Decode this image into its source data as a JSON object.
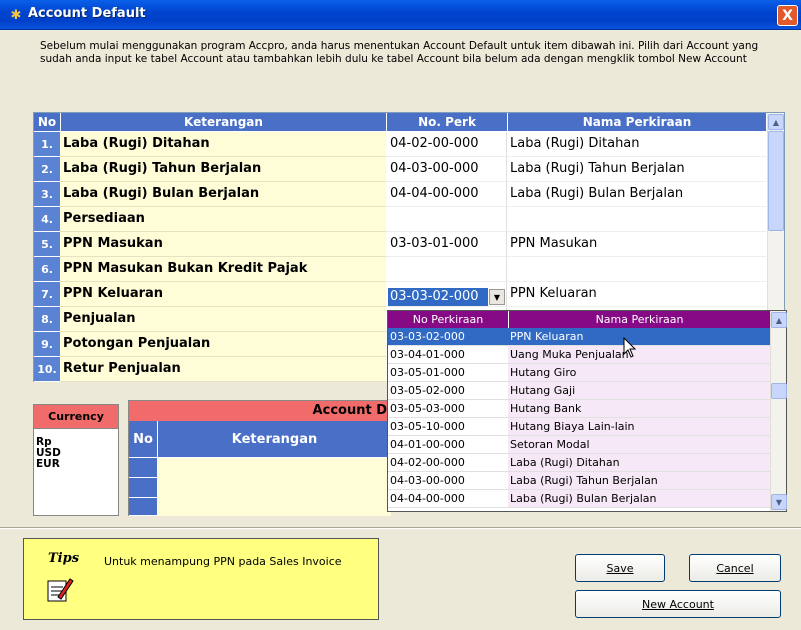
{
  "window": {
    "title": "Account Default",
    "close_label": "X"
  },
  "intro_text": "Sebelum mulai menggunakan program Accpro, anda harus menentukan  Account  Default untuk item dibawah ini. Pilih dari Account yang sudah anda input ke tabel Account atau tambahkan lebih dulu ke tabel Account bila belum ada dengan mengklik tombol New Account",
  "grid": {
    "headers": {
      "no": "No",
      "keterangan": "Keterangan",
      "no_perk": "No. Perk",
      "nama": "Nama Perkiraan"
    },
    "rows": [
      {
        "no": "1.",
        "keterangan": "Laba (Rugi) Ditahan",
        "no_perk": "04-02-00-000",
        "nama": "Laba (Rugi) Ditahan"
      },
      {
        "no": "2.",
        "keterangan": "Laba (Rugi) Tahun Berjalan",
        "no_perk": "04-03-00-000",
        "nama": "Laba (Rugi) Tahun Berjalan"
      },
      {
        "no": "3.",
        "keterangan": "Laba (Rugi) Bulan Berjalan",
        "no_perk": "04-04-00-000",
        "nama": "Laba (Rugi) Bulan Berjalan"
      },
      {
        "no": "4.",
        "keterangan": "Persediaan",
        "no_perk": "",
        "nama": ""
      },
      {
        "no": "5.",
        "keterangan": "PPN Masukan",
        "no_perk": "03-03-01-000",
        "nama": "PPN Masukan"
      },
      {
        "no": "6.",
        "keterangan": "PPN Masukan Bukan Kredit Pajak",
        "no_perk": "",
        "nama": ""
      },
      {
        "no": "7.",
        "keterangan": "PPN Keluaran",
        "no_perk": "",
        "nama": "PPN Keluaran"
      },
      {
        "no": "8.",
        "keterangan": "Penjualan",
        "no_perk": "",
        "nama": ""
      },
      {
        "no": "9.",
        "keterangan": "Potongan Penjualan",
        "no_perk": "",
        "nama": ""
      },
      {
        "no": "10.",
        "keterangan": "Retur Penjualan",
        "no_perk": "",
        "nama": ""
      }
    ],
    "combo_value": "03-03-02-000"
  },
  "dropdown": {
    "headers": {
      "no": "No Perkiraan",
      "nama": "Nama Perkiraan"
    },
    "rows": [
      {
        "no": "03-03-02-000",
        "nama": "PPN Keluaran"
      },
      {
        "no": "03-04-01-000",
        "nama": "Uang Muka Penjualan"
      },
      {
        "no": "03-05-01-000",
        "nama": "Hutang Giro"
      },
      {
        "no": "03-05-02-000",
        "nama": "Hutang Gaji"
      },
      {
        "no": "03-05-03-000",
        "nama": "Hutang Bank"
      },
      {
        "no": "03-05-10-000",
        "nama": "Hutang Biaya Lain-lain"
      },
      {
        "no": "04-01-00-000",
        "nama": "Setoran Modal"
      },
      {
        "no": "04-02-00-000",
        "nama": "Laba (Rugi) Ditahan"
      },
      {
        "no": "04-03-00-000",
        "nama": "Laba (Rugi) Tahun Berjalan"
      },
      {
        "no": "04-04-00-000",
        "nama": "Laba (Rugi) Bulan Berjalan"
      }
    ]
  },
  "currency": {
    "title": "Currency",
    "items": [
      "Rp",
      "USD",
      "EUR"
    ]
  },
  "account_panel": {
    "title": "Account D",
    "headers": {
      "no": "No",
      "keterangan": "Keterangan"
    }
  },
  "tips": {
    "label": "Tips",
    "text": "Untuk menampung PPN pada Sales Invoice"
  },
  "buttons": {
    "save": "Save",
    "cancel": "Cancel",
    "new_account": "New Account"
  },
  "colors": {
    "titlebar": "#0A5FE8",
    "grid_header": "#4A6FC7",
    "dropdown_header": "#860A86",
    "selection": "#316AC5",
    "currency_header": "#F26B6B",
    "tips_bg": "#FFFF80"
  }
}
